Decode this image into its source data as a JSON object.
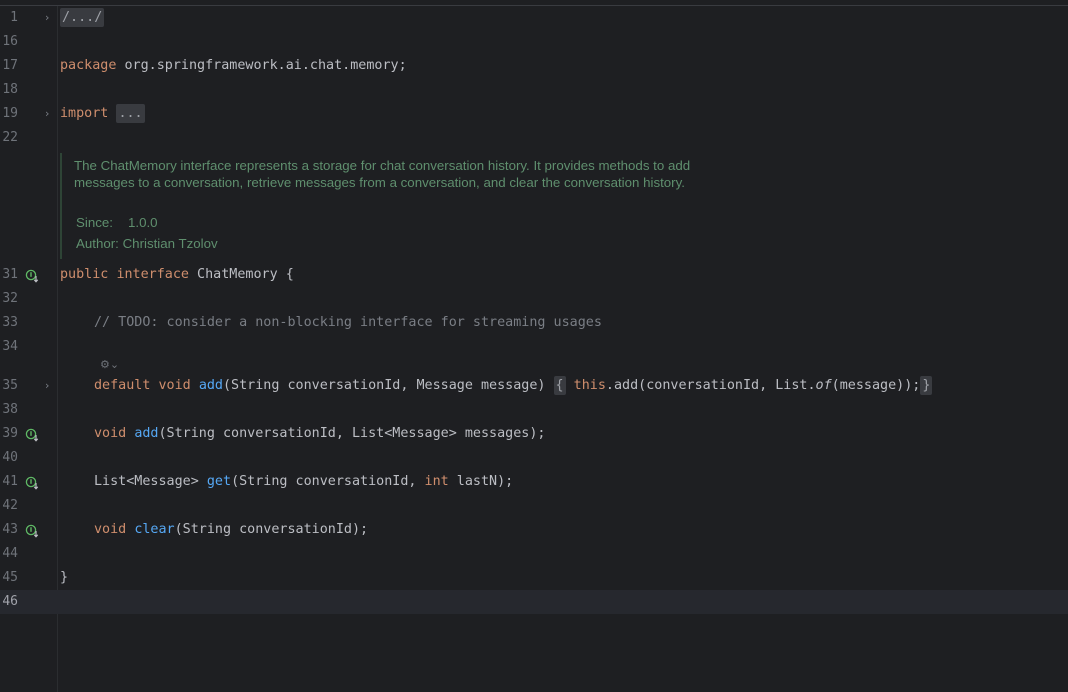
{
  "editor": {
    "lines": {
      "l1": {
        "num": "1",
        "fold": "›",
        "text": "/.../"
      },
      "l16": {
        "num": "16"
      },
      "l17": {
        "num": "17",
        "kw": "package",
        "rest": " org.springframework.ai.chat.memory;"
      },
      "l18": {
        "num": "18"
      },
      "l19": {
        "num": "19",
        "fold": "›",
        "kw": "import",
        "folded": "..."
      },
      "l22": {
        "num": "22"
      },
      "l31": {
        "num": "31",
        "kw1": "public",
        "kw2": "interface",
        "rest": " ChatMemory {"
      },
      "l32": {
        "num": "32"
      },
      "l33": {
        "num": "33",
        "comment": "// TODO: consider a non-blocking interface for streaming usages"
      },
      "l34": {
        "num": "34"
      },
      "l35": {
        "num": "35",
        "fold": "›",
        "kw1": "default",
        "kw2": "void",
        "fn": "add",
        "params": "(String conversationId, Message message)",
        "open": "{",
        "this_kw": "this",
        "body1": ".add(conversationId, List.",
        "of": "of",
        "body2": "(message));",
        "close": "}"
      },
      "l38": {
        "num": "38"
      },
      "l39": {
        "num": "39",
        "kw": "void",
        "fn": "add",
        "rest": "(String conversationId, List<Message> messages);"
      },
      "l40": {
        "num": "40"
      },
      "l41": {
        "num": "41",
        "pre": "List<Message> ",
        "fn": "get",
        "mid": "(String conversationId, ",
        "kw": "int",
        "rest": " lastN);"
      },
      "l42": {
        "num": "42"
      },
      "l43": {
        "num": "43",
        "kw": "void",
        "fn": "clear",
        "rest": "(String conversationId);"
      },
      "l44": {
        "num": "44"
      },
      "l45": {
        "num": "45",
        "text": "}"
      },
      "l46": {
        "num": "46"
      }
    },
    "javadoc": {
      "text": "The ChatMemory interface represents a storage for chat conversation history. It provides methods to add messages to a conversation, retrieve messages from a conversation, and clear the conversation history.",
      "since_label": "Since:",
      "since_value": "1.0.0",
      "author_label": "Author:",
      "author_value": "Christian Tzolov"
    },
    "inlay_hint": "⚙⌄",
    "colors": {
      "background": "#1e1f22",
      "keyword": "#cf8e6d",
      "function": "#56a8f5",
      "comment": "#7a7e85",
      "doc": "#5f8f6e",
      "implemented_icon": "#5fb865"
    }
  }
}
